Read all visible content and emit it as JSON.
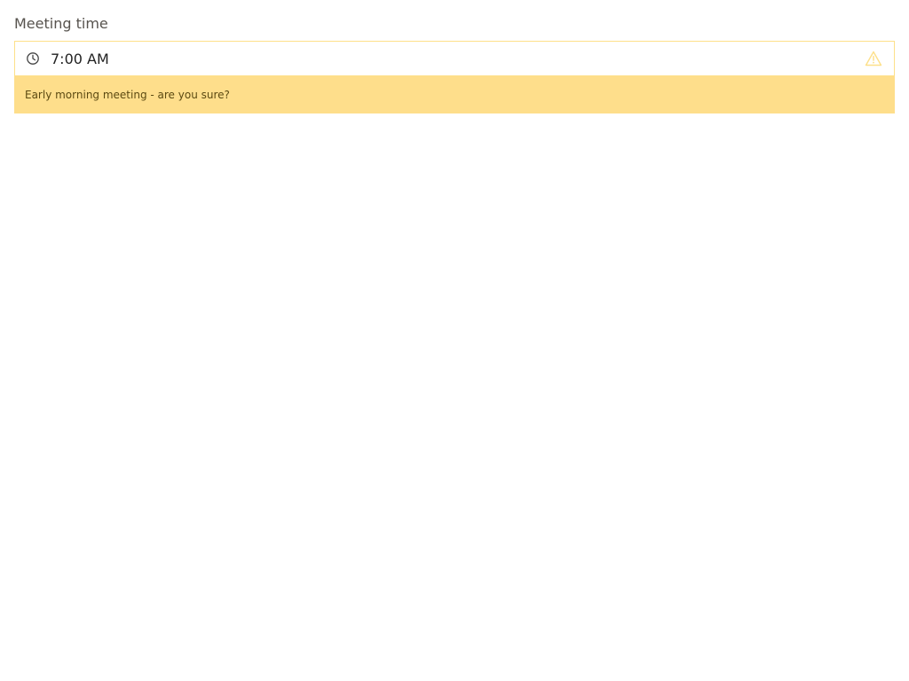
{
  "field": {
    "label": "Meeting time",
    "value": "7:00 AM",
    "icon": "clock-icon",
    "status_icon": "warning-icon"
  },
  "warning": {
    "message": "Early morning meeting - are you sure?",
    "color": "#fede8b",
    "border_color": "#fde08a"
  }
}
